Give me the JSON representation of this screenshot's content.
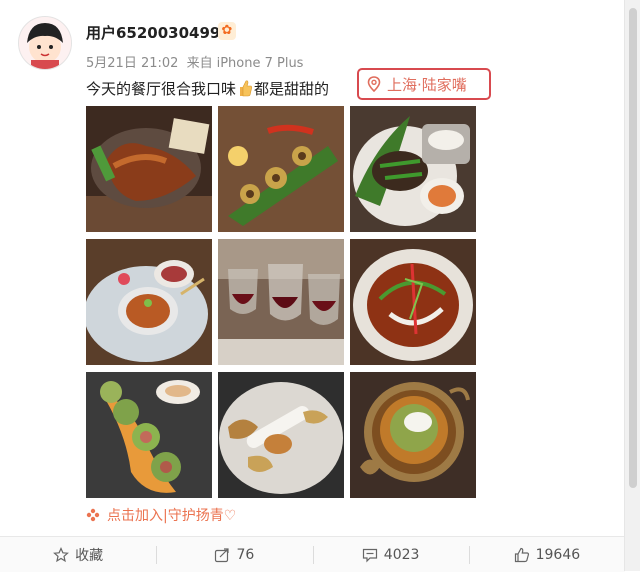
{
  "post": {
    "username": "用户6520030499",
    "date": "5月21日 21:02",
    "source_prefix": "来自",
    "device": "iPhone 7 Plus",
    "text_before_emoji": "今天的餐厅很合我口味",
    "text_after_emoji": "都是甜甜的",
    "location": "上海·陆家嘴",
    "supertopic": "点击加入|守护扬青♡"
  },
  "colors": {
    "location_border": "#d84a4f",
    "location_text": "#e06e5e",
    "link_orange": "#eb7350"
  },
  "icons": {
    "vip": "vip-badge-icon",
    "thumb": "thumbs-up-emoji-icon",
    "location": "location-pin-icon",
    "supertopic": "flower-icon",
    "favorite": "star-icon",
    "repost": "share-arrow-icon",
    "comment": "comment-icon",
    "like": "like-icon"
  },
  "actions": {
    "favorite_label": "收藏",
    "repost_count": "76",
    "comment_count": "4023",
    "like_count": "19646"
  }
}
